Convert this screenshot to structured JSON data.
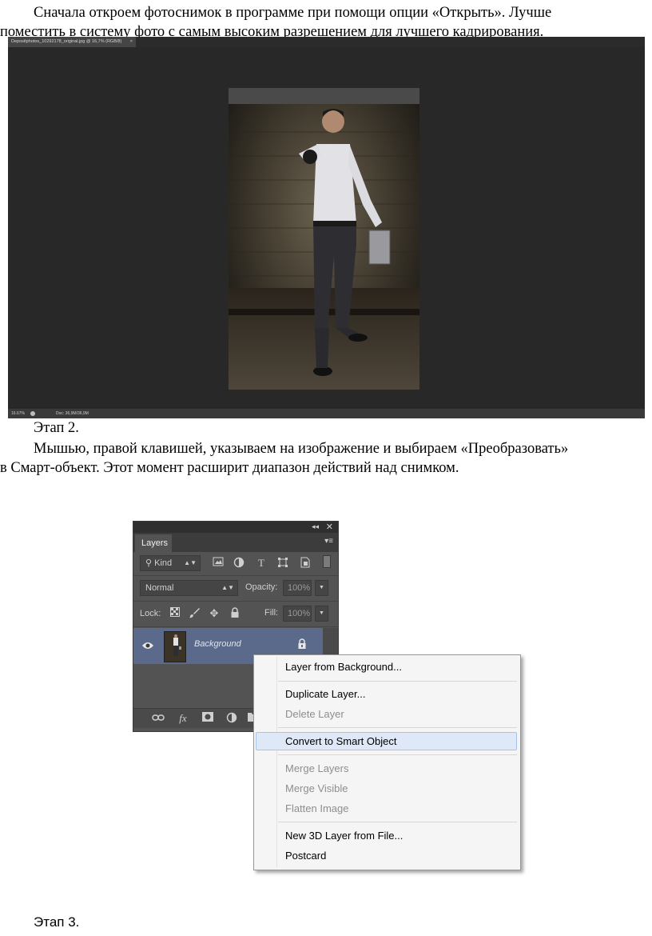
{
  "paragraph1": {
    "line1": "Сначала откроем фотоснимок в программе при помощи опции «Открыть». Лучше",
    "line2": "поместить в систему фото с самым высоким разрешением для лучшего кадрирования."
  },
  "photoshop_window": {
    "tab_title": "Depositphotos_10292178_original.jpg @ 16,7% (RGB/8)",
    "tab_close": "×",
    "zoom": "16.67%",
    "doc_info": "Doc: 36,9M/36,9M"
  },
  "step2_label": "Этап 2.",
  "paragraph2": {
    "line1": "Мышью, правой клавишей, указываем на изображение и выбираем «Преобразовать»",
    "line2": "в Смарт-объект. Этот момент расширит диапазон действий над снимком."
  },
  "layers_panel": {
    "collapse_icon": "◂◂",
    "close_icon": "✕",
    "tab_label": "Layers",
    "menu_icon": "▾≡",
    "kind_label": "Kind",
    "kind_search_icon": "⚲",
    "blend_mode": "Normal",
    "opacity_label": "Opacity:",
    "opacity_value": "100%",
    "lock_label": "Lock:",
    "fill_label": "Fill:",
    "fill_value": "100%",
    "layer_name": "Background"
  },
  "context_menu": {
    "items": [
      {
        "label": "Layer from Background...",
        "enabled": true
      },
      {
        "label": "Duplicate Layer...",
        "enabled": true
      },
      {
        "label": "Delete Layer",
        "enabled": false
      },
      {
        "label": "Convert to Smart Object",
        "enabled": true,
        "highlighted": true
      },
      {
        "label": "Merge Layers",
        "enabled": false
      },
      {
        "label": "Merge Visible",
        "enabled": false
      },
      {
        "label": "Flatten Image",
        "enabled": false
      },
      {
        "label": "New 3D Layer from File...",
        "enabled": true
      },
      {
        "label": "Postcard",
        "enabled": true
      }
    ]
  },
  "step3_label": "Этап 3.",
  "colors": {
    "ps_background": "#282828",
    "panel_gray": "#535353",
    "layer_selected": "#5b6a8a",
    "menu_highlight": "#dfe8f6"
  }
}
